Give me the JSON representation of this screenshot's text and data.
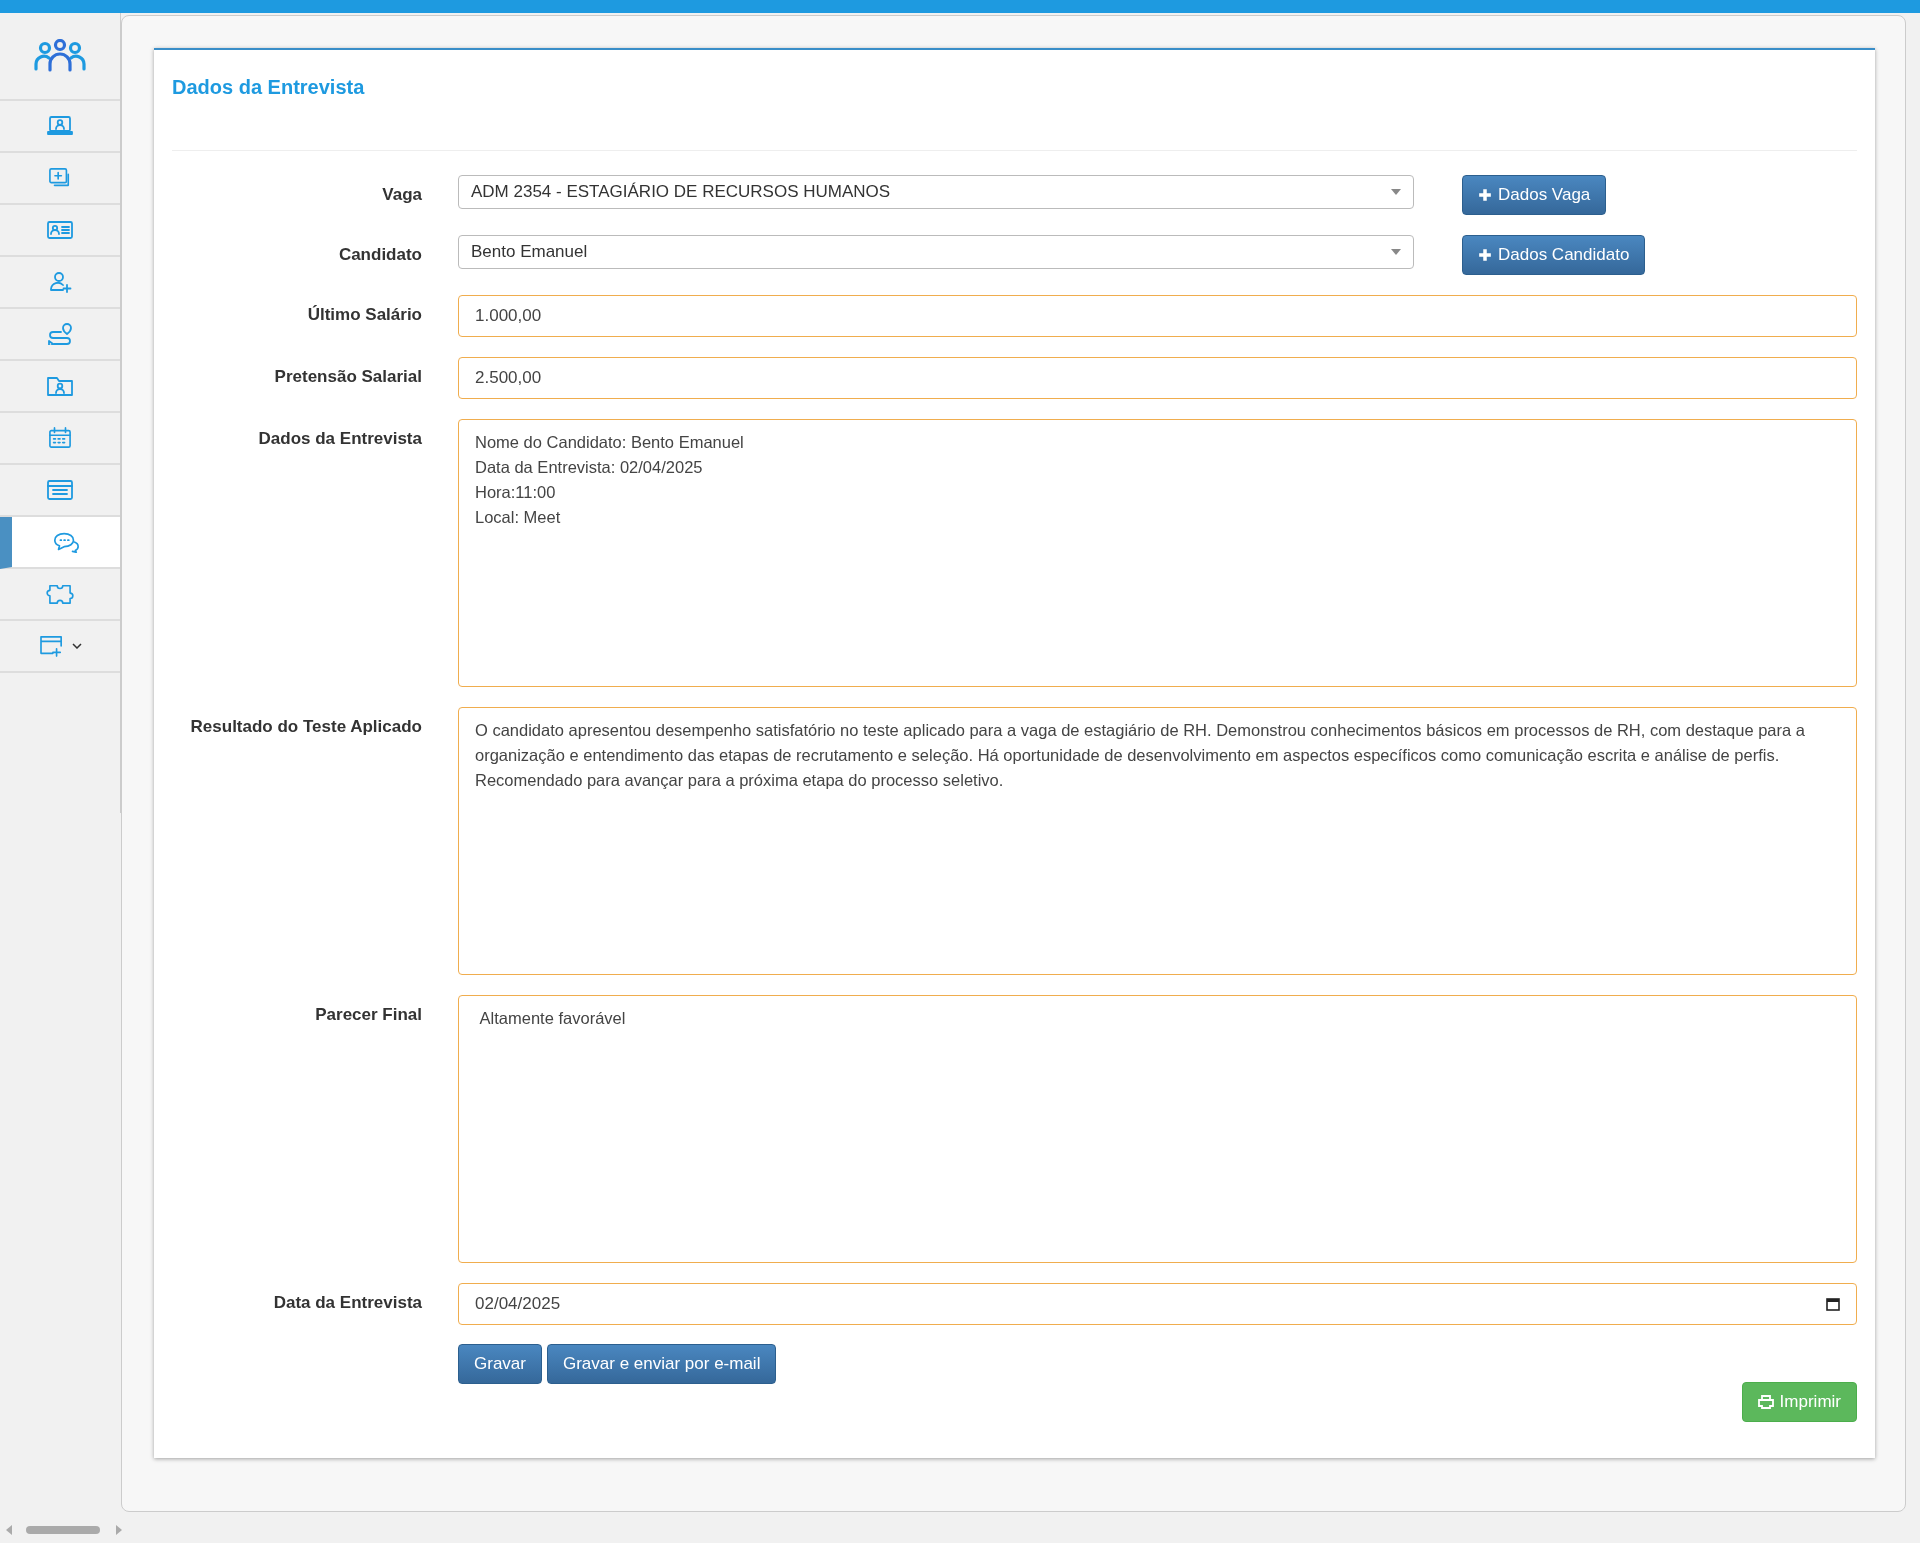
{
  "sidebar": {
    "items": [
      {
        "selected": false,
        "dropdown": false
      },
      {
        "selected": false,
        "dropdown": false
      },
      {
        "selected": false,
        "dropdown": false
      },
      {
        "selected": false,
        "dropdown": false
      },
      {
        "selected": false,
        "dropdown": false
      },
      {
        "selected": false,
        "dropdown": false
      },
      {
        "selected": false,
        "dropdown": false
      },
      {
        "selected": false,
        "dropdown": false
      },
      {
        "selected": true,
        "dropdown": false
      },
      {
        "selected": false,
        "dropdown": false
      },
      {
        "selected": false,
        "dropdown": true
      }
    ]
  },
  "card": {
    "title": "Dados da Entrevista",
    "fields": [
      {
        "kind": "select",
        "label": "Vaga",
        "value": "ADM 2354 - ESTAGIÁRIO DE RECURSOS HUMANOS",
        "button": "Dados Vaga"
      },
      {
        "kind": "select",
        "label": "Candidato",
        "value": "Bento Emanuel",
        "button": "Dados Candidato"
      },
      {
        "kind": "input",
        "label": "Último Salário",
        "value": "1.000,00"
      },
      {
        "kind": "input",
        "label": "Pretensão Salarial",
        "value": "2.500,00"
      },
      {
        "kind": "textarea",
        "label": "Dados da Entrevista",
        "value": "Nome do Candidato: Bento Emanuel\nData da Entrevista: 02/04/2025\nHora:11:00\nLocal: Meet"
      },
      {
        "kind": "textarea",
        "label": "Resultado do Teste Aplicado",
        "value": "O candidato apresentou desempenho satisfatório no teste aplicado para a vaga de estagiário de RH. Demonstrou conhecimentos básicos em processos de RH, com destaque para a organização e entendimento das etapas de recrutamento e seleção. Há oportunidade de desenvolvimento em aspectos específicos como comunicação escrita e análise de perfis. Recomendado para avançar para a próxima etapa do processo seletivo."
      },
      {
        "kind": "textarea",
        "label": "Parecer Final",
        "value": " Altamente favorável"
      },
      {
        "kind": "date",
        "label": "Data da Entrevista",
        "value": "02/04/2025"
      }
    ],
    "buttons": [
      "Gravar",
      "Gravar e enviar por e-mail"
    ],
    "print_button": "Imprimir"
  }
}
